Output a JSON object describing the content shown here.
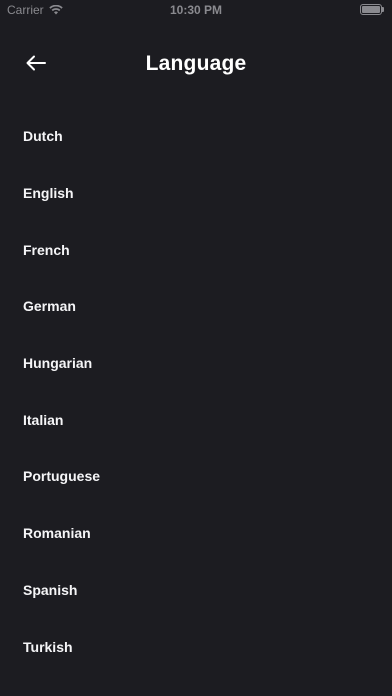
{
  "status_bar": {
    "carrier": "Carrier",
    "time": "10:30 PM",
    "battery_level": 1.0
  },
  "header": {
    "title": "Language",
    "back_icon": "arrow-left-icon"
  },
  "languages": [
    {
      "label": "Dutch"
    },
    {
      "label": "English"
    },
    {
      "label": "French"
    },
    {
      "label": "German"
    },
    {
      "label": "Hungarian"
    },
    {
      "label": "Italian"
    },
    {
      "label": "Portuguese"
    },
    {
      "label": "Romanian"
    },
    {
      "label": "Spanish"
    },
    {
      "label": "Turkish"
    }
  ],
  "colors": {
    "background": "#1c1c21",
    "text": "#ffffff",
    "status_text": "#8a8a8f"
  }
}
